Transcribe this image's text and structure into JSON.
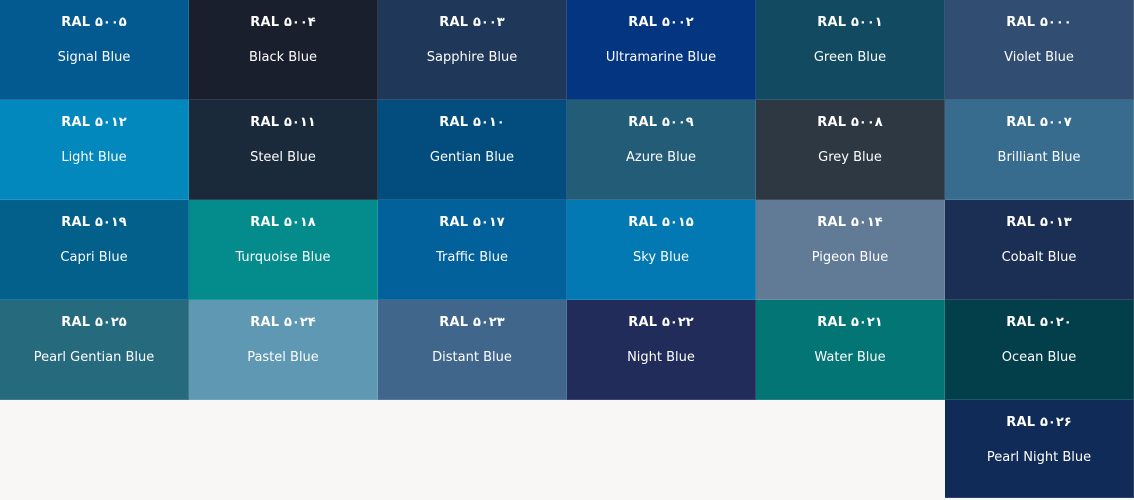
{
  "swatches": [
    {
      "code": "RAL ۵۰۰۵",
      "name": "Signal Blue",
      "color": "#035a91"
    },
    {
      "code": "RAL ۵۰۰۴",
      "name": "Black Blue",
      "color": "#1a1f2d"
    },
    {
      "code": "RAL ۵۰۰۳",
      "name": "Sapphire Blue",
      "color": "#1f3759"
    },
    {
      "code": "RAL ۵۰۰۲",
      "name": "Ultramarine Blue",
      "color": "#033580"
    },
    {
      "code": "RAL ۵۰۰۱",
      "name": "Green Blue",
      "color": "#114a61"
    },
    {
      "code": "RAL ۵۰۰۰",
      "name": "Violet Blue",
      "color": "#314d71"
    },
    {
      "code": "RAL ۵۰۱۲",
      "name": "Light Blue",
      "color": "#0388bd"
    },
    {
      "code": "RAL ۵۰۱۱",
      "name": "Steel Blue",
      "color": "#1a2a3a"
    },
    {
      "code": "RAL ۵۰۱۰",
      "name": "Gentian Blue",
      "color": "#024d7e"
    },
    {
      "code": "RAL ۵۰۰۹",
      "name": "Azure Blue",
      "color": "#235c76"
    },
    {
      "code": "RAL ۵۰۰۸",
      "name": "Grey Blue",
      "color": "#2d3843"
    },
    {
      "code": "RAL ۵۰۰۷",
      "name": "Brilliant Blue",
      "color": "#376c8f"
    },
    {
      "code": "RAL ۵۰۱۹",
      "name": "Capri Blue",
      "color": "#02608b"
    },
    {
      "code": "RAL ۵۰۱۸",
      "name": "Turquoise Blue",
      "color": "#048b8c"
    },
    {
      "code": "RAL ۵۰۱۷",
      "name": "Traffic Blue",
      "color": "#02609b"
    },
    {
      "code": "RAL ۵۰۱۵",
      "name": "Sky Blue",
      "color": "#0279b3"
    },
    {
      "code": "RAL ۵۰۱۴",
      "name": "Pigeon Blue",
      "color": "#617b96"
    },
    {
      "code": "RAL ۵۰۱۳",
      "name": "Cobalt Blue",
      "color": "#1b2e54"
    },
    {
      "code": "RAL ۵۰۲۵",
      "name": "Pearl Gentian Blue",
      "color": "#266a7e"
    },
    {
      "code": "RAL ۵۰۲۴",
      "name": "Pastel Blue",
      "color": "#5f98b3"
    },
    {
      "code": "RAL ۵۰۲۳",
      "name": "Distant Blue",
      "color": "#41668c"
    },
    {
      "code": "RAL ۵۰۲۲",
      "name": "Night Blue",
      "color": "#212c5a"
    },
    {
      "code": "RAL ۵۰۲۱",
      "name": "Water Blue",
      "color": "#047575"
    },
    {
      "code": "RAL ۵۰۲۰",
      "name": "Ocean Blue",
      "color": "#033e4b"
    },
    {
      "code": "RAL ۵۰۲۶",
      "name": "Pearl Night Blue",
      "color": "#102b57",
      "column": 6
    }
  ]
}
